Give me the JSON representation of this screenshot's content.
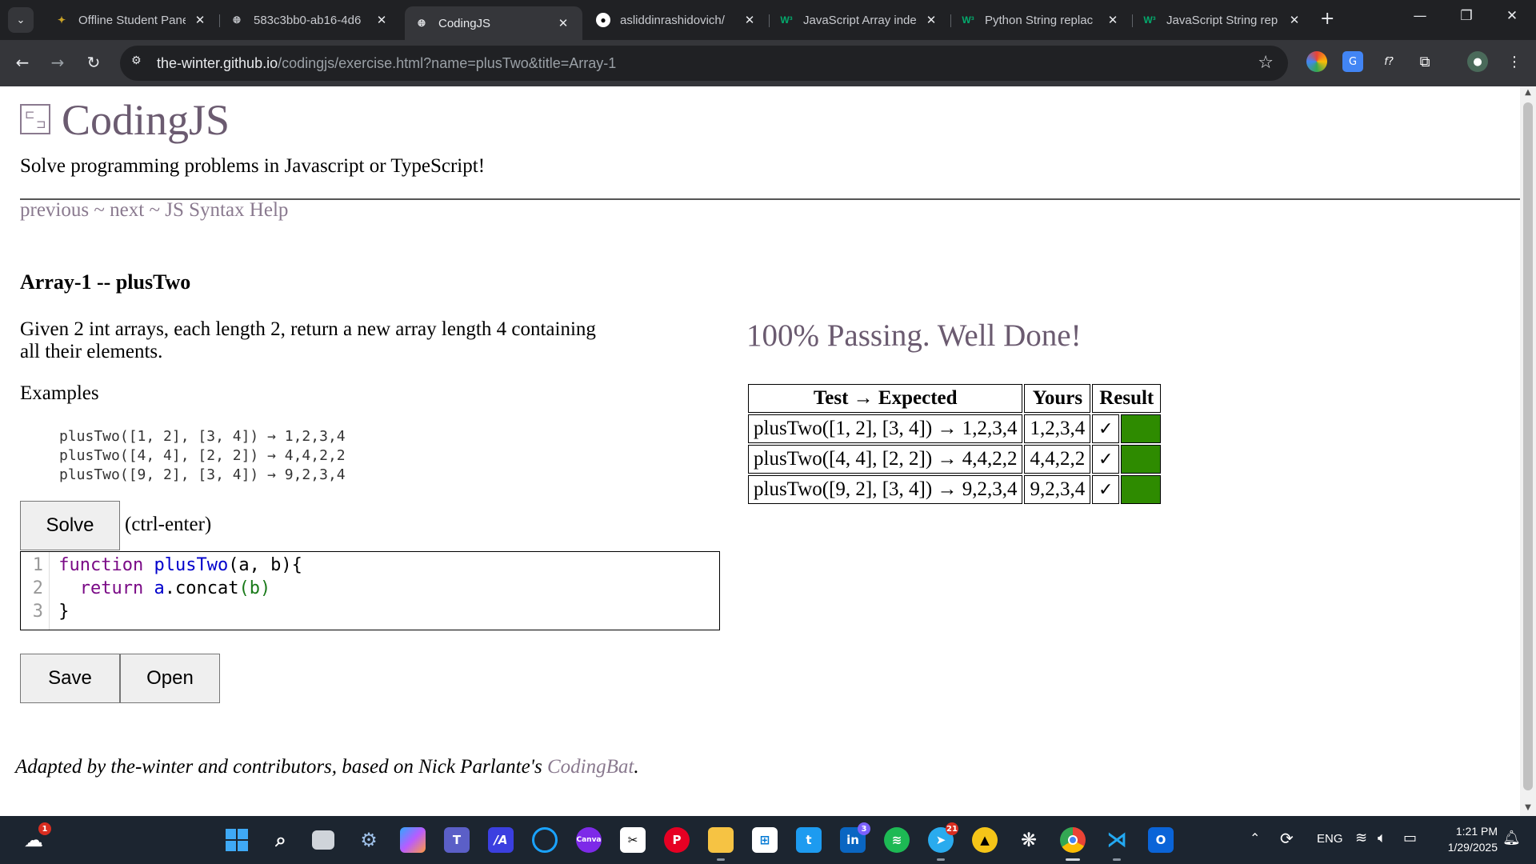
{
  "browser": {
    "tabs": [
      {
        "title": "Offline Student Panel",
        "icon": "app-icon",
        "active": false
      },
      {
        "title": "583c3bb0-ab16-4d6",
        "icon": "globe-icon",
        "active": false
      },
      {
        "title": "CodingJS",
        "icon": "globe-icon",
        "active": true
      },
      {
        "title": "asliddinrashidovich/",
        "icon": "github-icon",
        "active": false
      },
      {
        "title": "JavaScript Array inde",
        "icon": "w3schools-icon",
        "active": false
      },
      {
        "title": "Python String replac",
        "icon": "w3schools-icon",
        "active": false
      },
      {
        "title": "JavaScript String rep",
        "icon": "w3schools-icon",
        "active": false
      }
    ],
    "url_host": "the-winter.github.io",
    "url_path": "/codingjs/exercise.html?name=plusTwo&title=Array-1"
  },
  "page": {
    "site_title": "CodingJS",
    "tagline": "Solve programming problems in Javascript or TypeScript!",
    "nav": {
      "previous": "previous",
      "sep1": " ~ ",
      "next": "next",
      "sep2": " ~ ",
      "help": "JS Syntax Help"
    },
    "problem_title": "Array-1 -- plusTwo",
    "problem_description": "Given 2 int arrays, each length 2, return a new array length 4 containing all their elements.",
    "examples_heading": "Examples",
    "examples": [
      "plusTwo([1, 2], [3, 4]) → 1,2,3,4",
      "plusTwo([4, 4], [2, 2]) → 4,4,2,2",
      "plusTwo([9, 2], [3, 4]) → 9,2,3,4"
    ],
    "solve_label": "Solve",
    "solve_hint": "(ctrl-enter)",
    "code_line_numbers": [
      "1",
      "2",
      "3"
    ],
    "code": {
      "l1_kw": "function",
      "l1_fn": "plusTwo",
      "l1_rest": "(a, b){",
      "l2_kw": "return",
      "l2_obj": "a",
      "l2_method": ".concat",
      "l2_args": "(b)",
      "l3": "}"
    },
    "save_label": "Save",
    "open_label": "Open",
    "passing_text": "100% Passing. Well Done!",
    "results_headers": [
      "Test → Expected",
      "Yours",
      "Result"
    ],
    "results_rows": [
      {
        "test": "plusTwo([1, 2], [3, 4]) → 1,2,3,4",
        "yours": "1,2,3,4",
        "mark": "✓",
        "status_color": "#2e8b00"
      },
      {
        "test": "plusTwo([4, 4], [2, 2]) → 4,4,2,2",
        "yours": "4,4,2,2",
        "mark": "✓",
        "status_color": "#2e8b00"
      },
      {
        "test": "plusTwo([9, 2], [3, 4]) → 9,2,3,4",
        "yours": "9,2,3,4",
        "mark": "✓",
        "status_color": "#2e8b00"
      }
    ],
    "footer_text": "Adapted by the-winter and contributors, based on Nick Parlante's ",
    "footer_link": "CodingBat",
    "footer_end": "."
  },
  "taskbar": {
    "weather_badge": "1",
    "teams_badge": "",
    "linkedin_badge": "3",
    "telegram_badge": "21",
    "language": "ENG",
    "time": "1:21 PM",
    "date": "1/29/2025"
  },
  "colors": {
    "accent_link": "#8a7a8f",
    "title": "#6b5b70",
    "pass_green": "#2e8b00"
  }
}
